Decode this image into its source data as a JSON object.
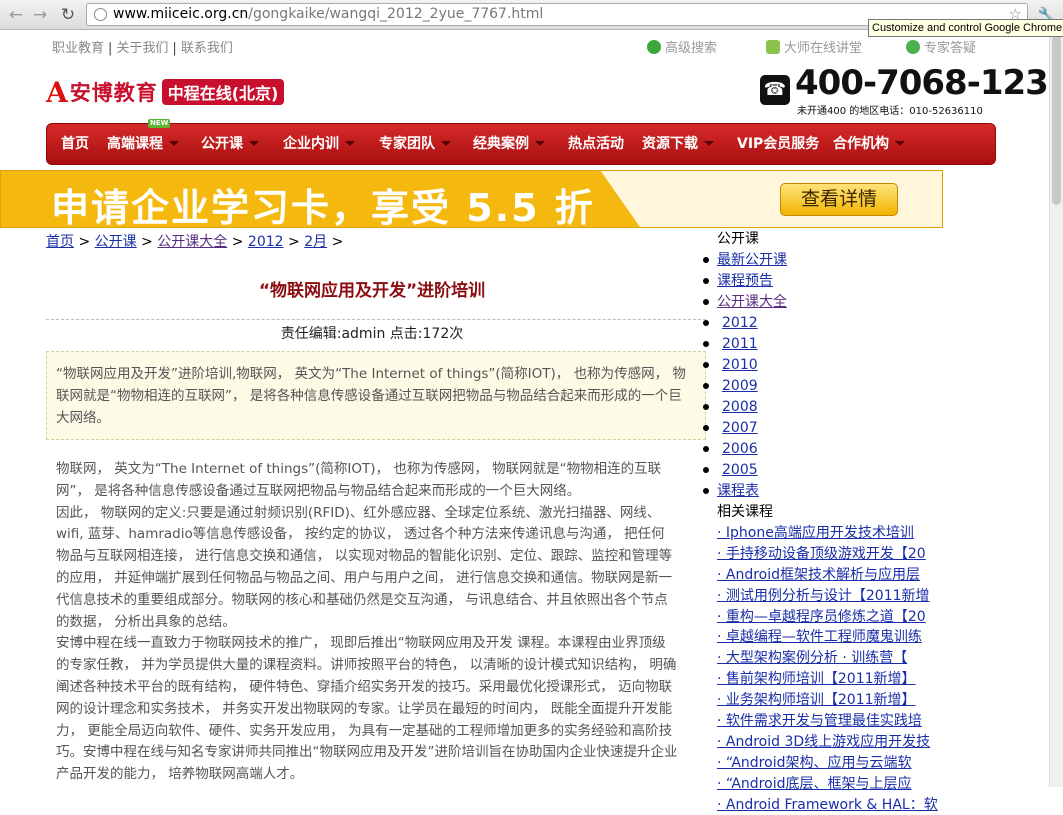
{
  "browser": {
    "url_host": "www.miiceic.org.cn",
    "url_path": "/gongkaike/wangqi_2012_2yue_7767.html",
    "tooltip": "Customize and control Google Chrome"
  },
  "toplinks": [
    "职业教育",
    "关于我们",
    "联系我们"
  ],
  "rightlinks": [
    "高级搜索",
    "大师在线讲堂",
    "专家答疑"
  ],
  "logo": {
    "mark": "A",
    "name": "安博教育",
    "badge": "中程在线(北京)"
  },
  "phone": {
    "number": "400-7068-123",
    "sub": "未开通400 的地区电话：010-52636110"
  },
  "nav": {
    "new_badge": "NEW",
    "items": [
      {
        "label": "首页",
        "arrow": false
      },
      {
        "label": "高端课程",
        "arrow": true
      },
      {
        "label": "公开课",
        "arrow": true
      },
      {
        "label": "企业内训",
        "arrow": true
      },
      {
        "label": "专家团队",
        "arrow": true
      },
      {
        "label": "经典案例",
        "arrow": true
      },
      {
        "label": "热点活动",
        "arrow": false
      },
      {
        "label": "资源下载",
        "arrow": true
      },
      {
        "label": "VIP会员服务",
        "arrow": false
      },
      {
        "label": "合作机构",
        "arrow": true
      }
    ]
  },
  "banner": {
    "text": "申请企业学习卡，享受 5.5 折",
    "button": "查看详情",
    "colors": {
      "bg": "#f5b80f",
      "text": "#ffffff"
    }
  },
  "breadcrumb": {
    "items": [
      "首页",
      "公开课",
      "公开课大全",
      "2012",
      "2月"
    ],
    "sep": ">"
  },
  "article": {
    "title": "“物联网应用及开发”进阶培训",
    "meta": "责任编辑:admin 点击:172次",
    "summary": "“物联网应用及开发”进阶培训,物联网， 英文为“The Internet of things”(简称IOT)， 也称为传感网， 物联网就是“物物相连的互联网”， 是将各种信息传感设备通过互联网把物品与物品结合起来而形成的一个巨大网络。",
    "paragraphs": [
      "物联网， 英文为“The Internet of things”(简称IOT)， 也称为传感网， 物联网就是“物物相连的互联网”， 是将各种信息传感设备通过互联网把物品与物品结合起来而形成的一个巨大网络。",
      "因此， 物联网的定义:只要是通过射频识别(RFID)、红外感应器、全球定位系统、激光扫描器、网线、wifi, 蓝芽、hamradio等信息传感设备， 按约定的协议， 透过各个种方法来传递讯息与沟通， 把任何物品与互联网相连接， 进行信息交换和通信， 以实现对物品的智能化识别、定位、跟踪、监控和管理等的应用， 并延伸端扩展到任何物品与物品之间、用户与用户之间， 进行信息交换和通信。物联网是新一代信息技术的重要组成部分。物联网的核心和基础仍然是交互沟通， 与讯息结合、并且依照出各个节点的数据， 分析出具象的总结。",
      "安博中程在线一直致力于物联网技术的推广， 现即后推出“物联网应用及开发 课程。本课程由业界顶级的专家任教， 并为学员提供大量的课程资料。讲师按照平台的特色， 以清晰的设计模式知识结构， 明确阐述各种技术平台的既有结构， 硬件特色、穿插介绍实务开发的技巧。采用最优化授课形式， 迈向物联网的设计理念和实务技术， 并务实开发出物联网的专家。让学员在最短的时间内， 既能全面提升开发能力， 更能全局迈向软件、硬件、实务开发应用， 为具有一定基础的工程师增加更多的实务经验和高阶技巧。安博中程在线与知名专家讲师共同推出“物联网应用及开发”进阶培训旨在协助国内企业快速提升企业产品开发的能力， 培养物联网高端人才。"
    ]
  },
  "sidebar": {
    "heading": "公开课",
    "links": [
      "最新公开课",
      "课程预告",
      "公开课大全"
    ],
    "years": [
      "2012",
      "2011",
      "2010",
      "2009",
      "2008",
      "2007",
      "2006",
      "2005"
    ],
    "schedule": "课程表",
    "related_heading": "相关课程",
    "related": [
      "· Iphone高端应用开发技术培训",
      "· 手持移动设备顶级游戏开发【20",
      "· Android框架技术解析与应用层",
      "· 测试用例分析与设计【2011新增",
      "· 重构—卓越程序员修炼之道【20",
      "· 卓越编程—软件工程师魔鬼训练",
      "· 大型架构案例分析 · 训练营【",
      "· 售前架构师培训【2011新增】",
      "· 业务架构师培训【2011新增】",
      "· 软件需求开发与管理最佳实践培",
      "· Android 3D线上游戏应用开发技",
      "· “Android架构、应用与云端软",
      "· “Android底层、框架与上层应",
      "· Android Framework & HAL：软"
    ]
  }
}
